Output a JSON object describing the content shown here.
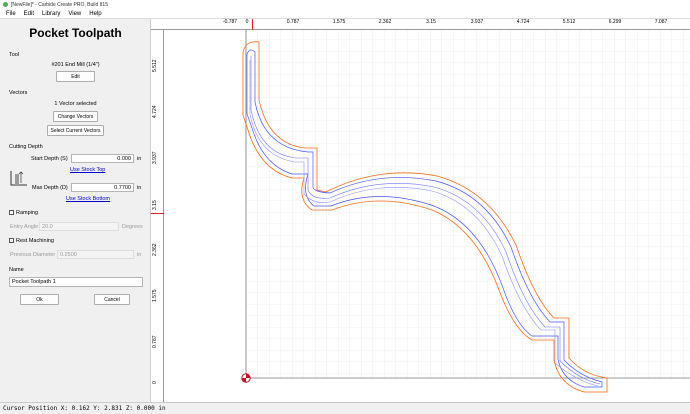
{
  "window": {
    "title": "[NewFile]* - Carbide Create PRO, Build 815"
  },
  "menu": [
    "File",
    "Edit",
    "Library",
    "View",
    "Help"
  ],
  "panel": {
    "title": "Pocket Toolpath",
    "tool_label": "Tool",
    "tool_name": "#201 End Mill (1/4\")",
    "edit_button": "Edit",
    "vectors_label": "Vectors",
    "vectors_status": "1 Vector selected",
    "change_vectors_button": "Change Vectors",
    "select_current_button": "Select Current Vectors",
    "cutting_depth_label": "Cutting Depth",
    "start_depth_label": "Start Depth (S)",
    "start_depth_value": "0.000",
    "start_depth_unit": "in",
    "use_stock_top": "Use Stock Top",
    "max_depth_label": "Max Depth (D)",
    "max_depth_value": "0.7700",
    "max_depth_unit": "in",
    "use_stock_bottom": "Use Stock Bottom",
    "ramping_label": "Ramping",
    "entry_angle_label": "Entry Angle",
    "entry_angle_value": "20.0",
    "entry_angle_unit": "Degrees",
    "rest_machining_label": "Rest Machining",
    "previous_diameter_label": "Previous Diameter",
    "previous_diameter_value": "0.2500",
    "previous_diameter_unit": "in",
    "name_label": "Name",
    "name_value": "Pocket Toolpath 1",
    "ok_button": "Ok",
    "cancel_button": "Cancel"
  },
  "ruler": {
    "x_ticks": [
      "-0.787",
      "0",
      "0.787",
      "1.575",
      "2.362",
      "3.15",
      "3.937",
      "4.724",
      "5.512",
      "6.299",
      "7.087"
    ],
    "y_ticks": [
      "5.512",
      "4.724",
      "3.937",
      "3.15",
      "2.362",
      "1.575",
      "0.787",
      "0"
    ]
  },
  "status": {
    "cursor_position": "Cursor Position X: 0.162 Y: 2.831 Z: 0.000 in"
  },
  "colors": {
    "offset_outline": "#ff6a13",
    "toolpath": "#4a55ff",
    "ruler_marker": "#e0202a"
  }
}
